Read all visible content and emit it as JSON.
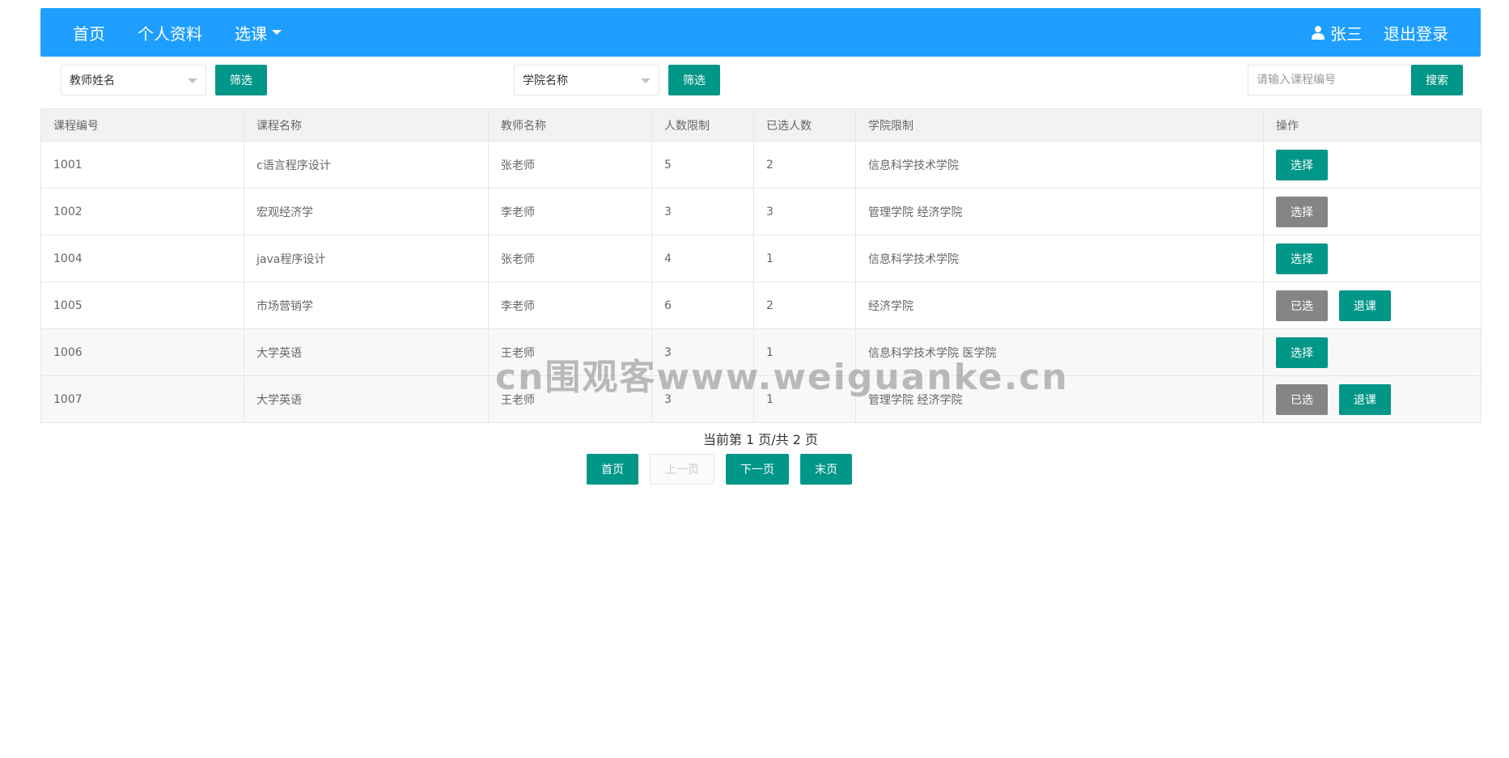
{
  "colors": {
    "nav_bg": "#1e9fff",
    "primary_btn": "#009688",
    "disabled_btn": "#858585"
  },
  "nav": {
    "items": [
      {
        "label": "首页"
      },
      {
        "label": "个人资料"
      },
      {
        "label": "选课"
      }
    ],
    "user_icon": "user-icon",
    "user_name": "张三",
    "logout": "退出登录"
  },
  "filters": {
    "teacher_select": "教师姓名",
    "teacher_filter_btn": "筛选",
    "college_select": "学院名称",
    "college_filter_btn": "筛选",
    "search_placeholder": "请输入课程编号",
    "search_btn": "搜索"
  },
  "table": {
    "headers": [
      "课程编号",
      "课程名称",
      "教师名称",
      "人数限制",
      "已选人数",
      "学院限制",
      "操作"
    ],
    "rows": [
      {
        "id": "1001",
        "name": "c语言程序设计",
        "teacher": "张老师",
        "limit": "5",
        "selected": "2",
        "college": "信息科学技术学院",
        "actions": [
          "选择"
        ]
      },
      {
        "id": "1002",
        "name": "宏观经济学",
        "teacher": "李老师",
        "limit": "3",
        "selected": "3",
        "college": "管理学院  经济学院",
        "actions": [
          "选择"
        ]
      },
      {
        "id": "1004",
        "name": "java程序设计",
        "teacher": "张老师",
        "limit": "4",
        "selected": "1",
        "college": "信息科学技术学院",
        "actions": [
          "选择"
        ]
      },
      {
        "id": "1005",
        "name": "市场营销学",
        "teacher": "李老师",
        "limit": "6",
        "selected": "2",
        "college": "经济学院",
        "actions": [
          "已选",
          "退课"
        ]
      },
      {
        "id": "1006",
        "name": "大学英语",
        "teacher": "王老师",
        "limit": "3",
        "selected": "1",
        "college": "信息科学技术学院  医学院",
        "actions": [
          "选择"
        ]
      },
      {
        "id": "1007",
        "name": "大学英语",
        "teacher": "王老师",
        "limit": "3",
        "selected": "1",
        "college": "管理学院  经济学院",
        "actions": [
          "已选",
          "退课"
        ]
      }
    ]
  },
  "pager": {
    "info": "当前第 1 页/共 2 页",
    "first": "首页",
    "prev": "上一页",
    "next": "下一页",
    "last": "末页"
  },
  "watermark": "cn围观客www.weiguanke.cn"
}
